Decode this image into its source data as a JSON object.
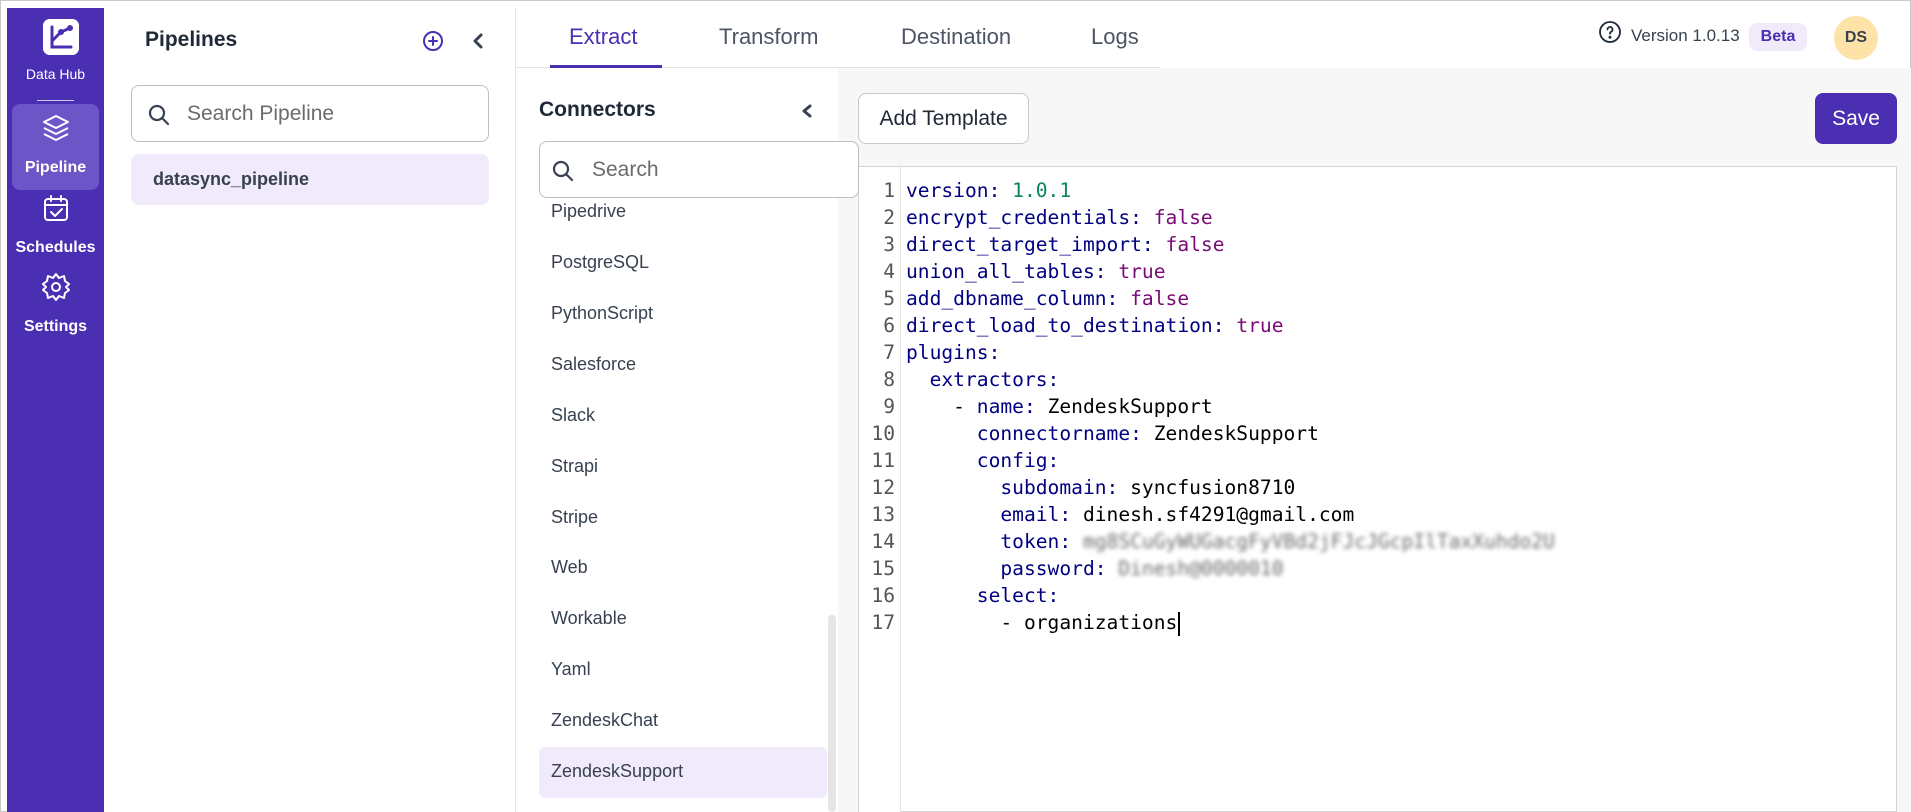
{
  "app": {
    "name": "Data Hub"
  },
  "nav": [
    {
      "label": "Pipeline",
      "icon": "layers-icon",
      "active": true
    },
    {
      "label": "Schedules",
      "icon": "calendar-check-icon",
      "active": false
    },
    {
      "label": "Settings",
      "icon": "gear-icon",
      "active": false
    }
  ],
  "pipelines": {
    "title": "Pipelines",
    "search_placeholder": "Search Pipeline",
    "items": [
      {
        "label": "datasync_pipeline",
        "selected": true
      }
    ]
  },
  "tabs": [
    {
      "label": "Extract",
      "active": true
    },
    {
      "label": "Transform",
      "active": false
    },
    {
      "label": "Destination",
      "active": false
    },
    {
      "label": "Logs",
      "active": false
    }
  ],
  "header": {
    "version": "Version 1.0.13",
    "badge": "Beta",
    "avatar_initials": "DS"
  },
  "connectors": {
    "title": "Connectors",
    "search_placeholder": "Search",
    "items": [
      {
        "label": "Pipedrive",
        "selected": false
      },
      {
        "label": "PostgreSQL",
        "selected": false
      },
      {
        "label": "PythonScript",
        "selected": false
      },
      {
        "label": "Salesforce",
        "selected": false
      },
      {
        "label": "Slack",
        "selected": false
      },
      {
        "label": "Strapi",
        "selected": false
      },
      {
        "label": "Stripe",
        "selected": false
      },
      {
        "label": "Web",
        "selected": false
      },
      {
        "label": "Workable",
        "selected": false
      },
      {
        "label": "Yaml",
        "selected": false
      },
      {
        "label": "ZendeskChat",
        "selected": false
      },
      {
        "label": "ZendeskSupport",
        "selected": true
      }
    ]
  },
  "toolbar": {
    "add_template": "Add Template",
    "save": "Save"
  },
  "editor": {
    "lines": [
      {
        "n": "1",
        "indent": "",
        "key": "version",
        "value": "1.0.1",
        "vtype": "num"
      },
      {
        "n": "2",
        "indent": "",
        "key": "encrypt_credentials",
        "value": "false",
        "vtype": "bool"
      },
      {
        "n": "3",
        "indent": "",
        "key": "direct_target_import",
        "value": "false",
        "vtype": "bool"
      },
      {
        "n": "4",
        "indent": "",
        "key": "union_all_tables",
        "value": "true",
        "vtype": "bool"
      },
      {
        "n": "5",
        "indent": "",
        "key": "add_dbname_column",
        "value": "false",
        "vtype": "bool"
      },
      {
        "n": "6",
        "indent": "",
        "key": "direct_load_to_destination",
        "value": "true",
        "vtype": "bool"
      },
      {
        "n": "7",
        "indent": "",
        "key": "plugins",
        "value": "",
        "vtype": "none"
      },
      {
        "n": "8",
        "indent": "  ",
        "key": "extractors",
        "value": "",
        "vtype": "none"
      },
      {
        "n": "9",
        "indent": "    - ",
        "key": "name",
        "value": "ZendeskSupport",
        "vtype": "str"
      },
      {
        "n": "10",
        "indent": "      ",
        "key": "connectorname",
        "value": "ZendeskSupport",
        "vtype": "str"
      },
      {
        "n": "11",
        "indent": "      ",
        "key": "config",
        "value": "",
        "vtype": "none"
      },
      {
        "n": "12",
        "indent": "        ",
        "key": "subdomain",
        "value": "syncfusion8710",
        "vtype": "str"
      },
      {
        "n": "13",
        "indent": "        ",
        "key": "email",
        "value": "dinesh.sf4291@gmail.com",
        "vtype": "str"
      },
      {
        "n": "14",
        "indent": "        ",
        "key": "token",
        "value": "mg8SCuGyWUGacgFyVBd2jFJcJGcpIlTaxXuhdo2U",
        "vtype": "secret"
      },
      {
        "n": "15",
        "indent": "        ",
        "key": "password",
        "value": "Dinesh@0000010",
        "vtype": "secret"
      },
      {
        "n": "16",
        "indent": "      ",
        "key": "select",
        "value": "",
        "vtype": "none"
      },
      {
        "n": "17",
        "indent": "        - ",
        "key": "",
        "value": "organizations",
        "vtype": "item"
      }
    ]
  }
}
